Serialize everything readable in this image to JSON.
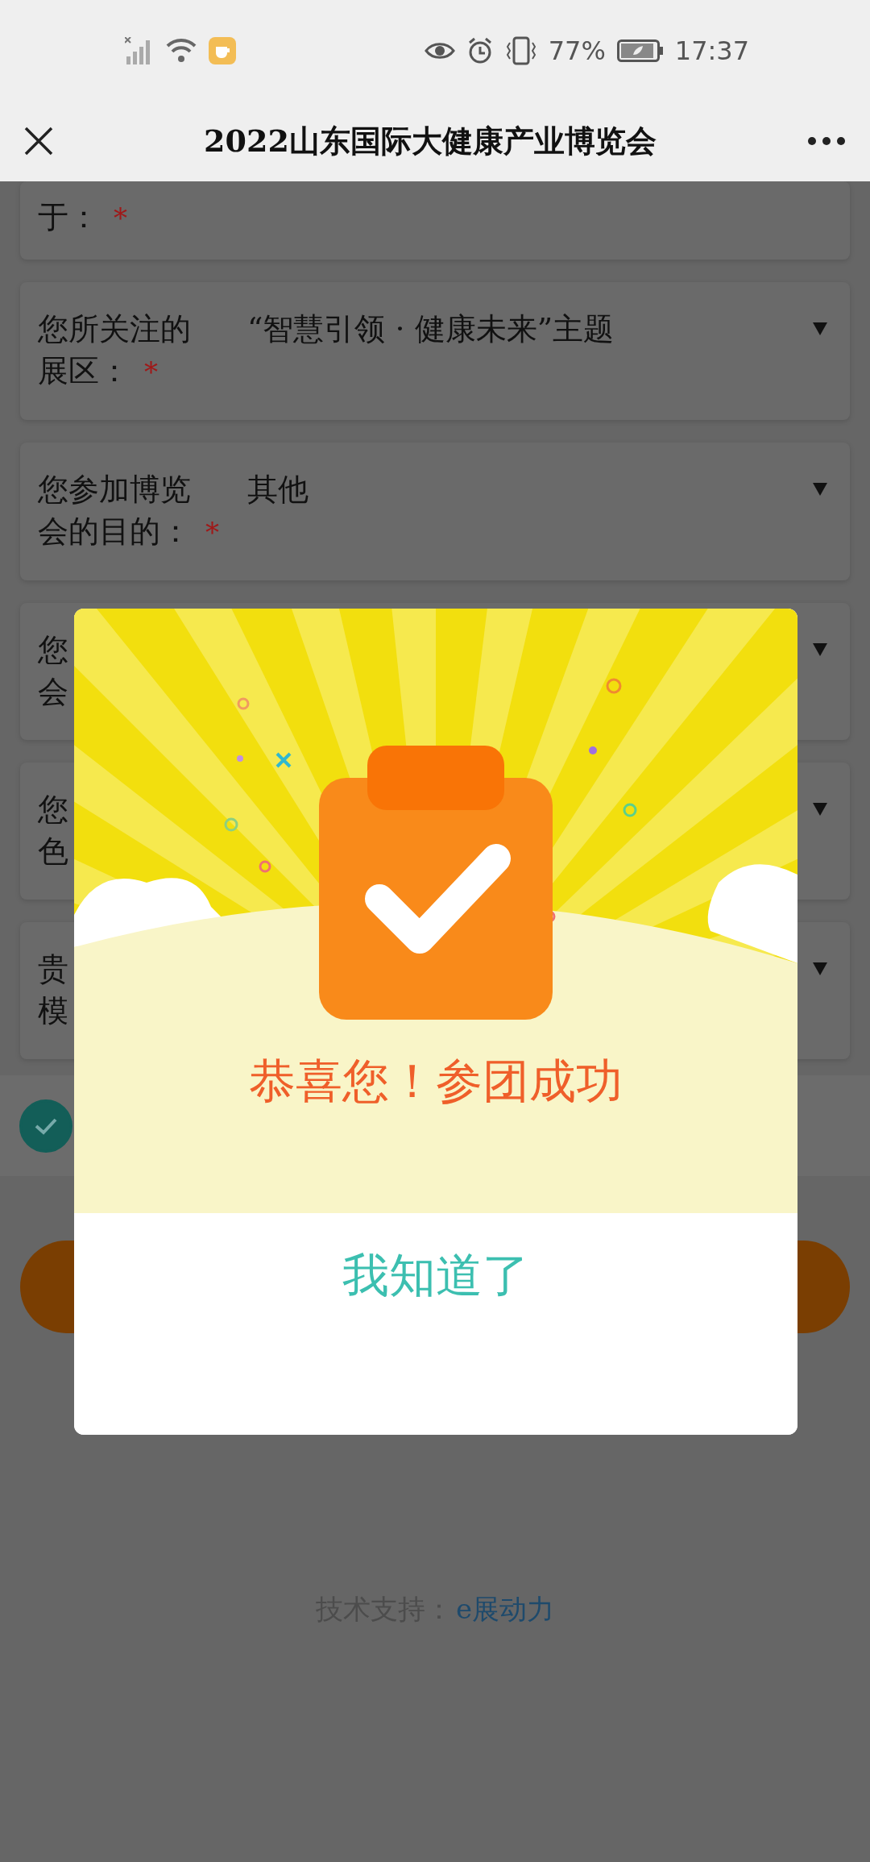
{
  "status_bar": {
    "battery": "77%",
    "time": "17:37"
  },
  "header": {
    "title": "2022山东国际大健康产业博览会"
  },
  "form": {
    "fields": [
      {
        "label_lines": [
          "于："
        ],
        "required_mark": "*"
      },
      {
        "label_lines": [
          "您所关注的",
          "展区："
        ],
        "required_mark": "*",
        "value": "“智慧引领 · 健康未来”主题"
      },
      {
        "label_lines": [
          "您参加博览",
          "会的目的："
        ],
        "required_mark": "*",
        "value": "其他"
      },
      {
        "label_lines": [
          "您",
          "会"
        ]
      },
      {
        "label_lines": [
          "您",
          "色"
        ]
      },
      {
        "label_lines": [
          "贵",
          "模"
        ]
      }
    ],
    "agreement": {
      "checked": true
    }
  },
  "footer": {
    "label": "技术支持：",
    "link": "e展动力"
  },
  "modal": {
    "title": "恭喜您！参团成功",
    "button": "我知道了"
  }
}
